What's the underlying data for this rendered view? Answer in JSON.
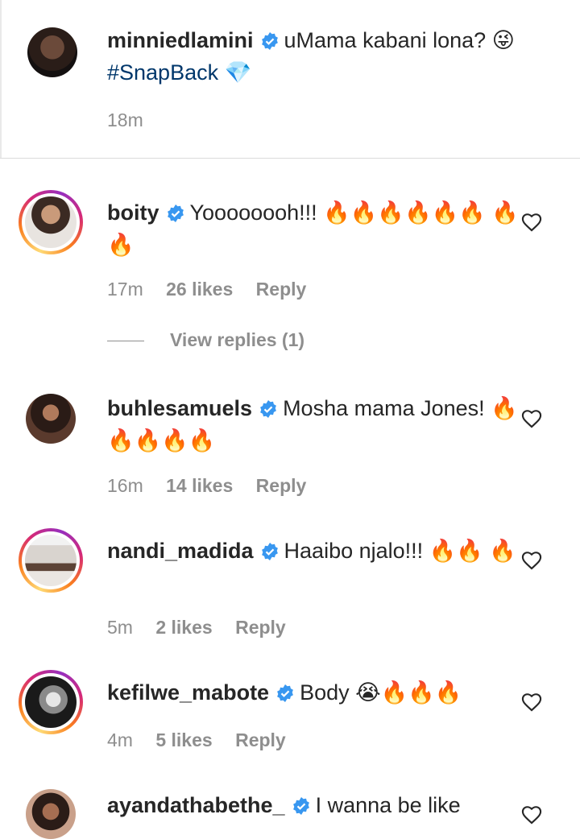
{
  "caption": {
    "username": "minniedlamini",
    "text": "uMama kabani lona? 😜",
    "hashtag": "#SnapBack 💎",
    "time": "18m"
  },
  "comments": [
    {
      "username": "boity",
      "text": "Yoooooooh!!! 🔥🔥🔥🔥🔥🔥 🔥🔥",
      "time": "17m",
      "likes": "26 likes",
      "reply": "Reply"
    },
    {
      "username": "buhlesamuels",
      "text": "Mosha mama Jones! 🔥🔥🔥🔥🔥",
      "time": "16m",
      "likes": "14 likes",
      "reply": "Reply"
    },
    {
      "username": "nandi_madida",
      "text": "Haaibo njalo!!! 🔥🔥 🔥",
      "time": "5m",
      "likes": "2 likes",
      "reply": "Reply"
    },
    {
      "username": "kefilwe_mabote",
      "text": "Body 😭🔥🔥🔥",
      "time": "4m",
      "likes": "5 likes",
      "reply": "Reply"
    },
    {
      "username": "ayandathabethe_",
      "text": "I wanna be like"
    }
  ],
  "view_replies": "View replies (1)",
  "icons": {
    "verified": "verified-badge-icon",
    "like": "heart-icon"
  },
  "colors": {
    "verified": "#3897f0",
    "muted": "#8e8e8e",
    "hashtag": "#00376b"
  }
}
